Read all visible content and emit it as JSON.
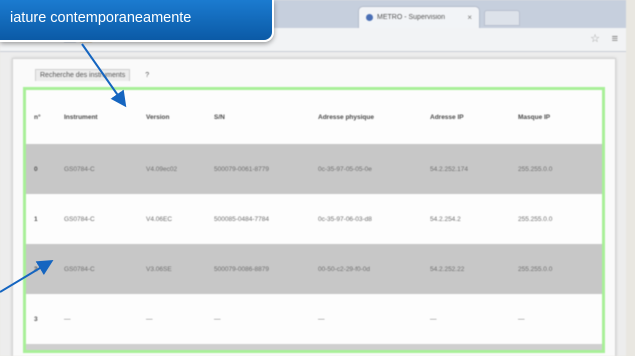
{
  "callout": {
    "text": "iature contemporaneamente"
  },
  "browser": {
    "tab_title": "METRO - Supervision",
    "tab_close": "×",
    "star_icon": "star-icon",
    "menu_icon": "hamburger-menu-icon"
  },
  "doc": {
    "tabs": [
      "Recherche des instruments",
      "?"
    ]
  },
  "table": {
    "headers": [
      "n°",
      "Instrument",
      "Version",
      "S/N",
      "Adresse physique",
      "Adresse IP",
      "Masque IP"
    ],
    "rows": [
      [
        "0",
        "GS0784-C",
        "V4.09ec02",
        "500079-0061-8779",
        "0c-35-97-05-05-0e",
        "54.2.252.174",
        "255.255.0.0"
      ],
      [
        "1",
        "GS0784-C",
        "V4.06EC",
        "500085-0484-7784",
        "0c-35-97-06-03-d8",
        "54.2.254.2",
        "255.255.0.0"
      ],
      [
        "2",
        "GS0784-C",
        "V3.06SE",
        "500079-0086-8879",
        "00-50-c2-29-f0-0d",
        "54.2.252.22",
        "255.255.0.0"
      ],
      [
        "3",
        "—",
        "—",
        "—",
        "—",
        "—",
        "—"
      ]
    ]
  },
  "colors": {
    "callout_bg": "#0b5aa6",
    "highlight_frame": "#a8ef98",
    "arrow": "#1565c0"
  }
}
